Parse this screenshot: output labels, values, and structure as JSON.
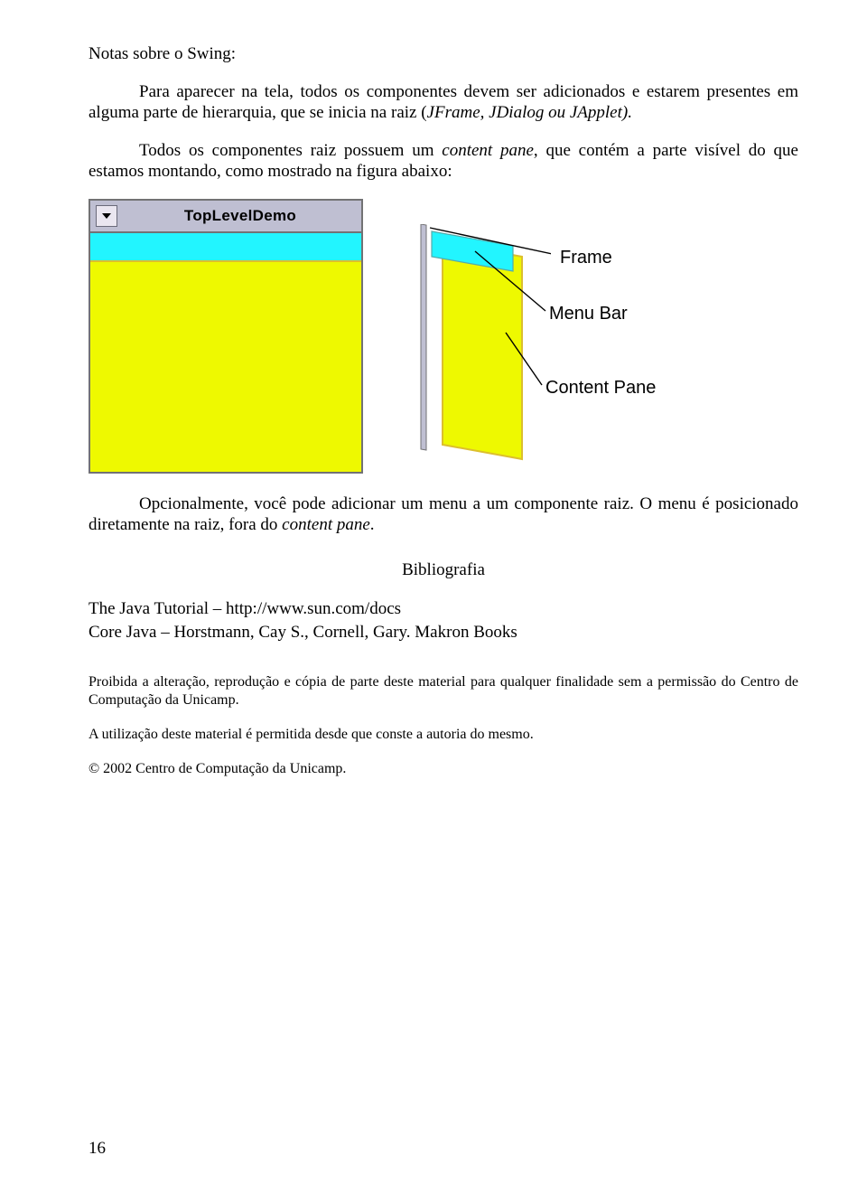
{
  "title": "Notas sobre o Swing:",
  "p1_a": "Para aparecer na tela, todos os componentes devem ser adicionados e estarem presentes em alguma parte de hierarquia, que se inicia na raiz (",
  "p1_b": "JFrame, JDialog ou JApplet).",
  "p2_a": "Todos os componentes raiz possuem um ",
  "p2_b": "content pane",
  "p2_c": ", que contém a parte visível do que estamos montando, como mostrado na figura abaixo:",
  "window_title": "TopLevelDemo",
  "labels": {
    "frame": "Frame",
    "menubar": "Menu Bar",
    "content_pane": "Content Pane"
  },
  "p3_a": "Opcionalmente, você pode adicionar um menu a um componente raiz. O menu é posicionado diretamente na raiz, fora do ",
  "p3_b": "content pane",
  "p3_c": ".",
  "biblio_title": "Bibliografia",
  "biblio1": "The Java Tutorial – http://www.sun.com/docs",
  "biblio2": "Core Java – Horstmann, Cay S., Cornell, Gary. Makron Books",
  "legal1": "Proibida a alteração, reprodução e cópia de parte deste material para qualquer finalidade sem a permissão do Centro de Computação da Unicamp.",
  "legal2": "A utilização deste material é permitida desde que conste a autoria do mesmo.",
  "copyright": "© 2002 Centro de Computação da Unicamp.",
  "page_number": "16"
}
